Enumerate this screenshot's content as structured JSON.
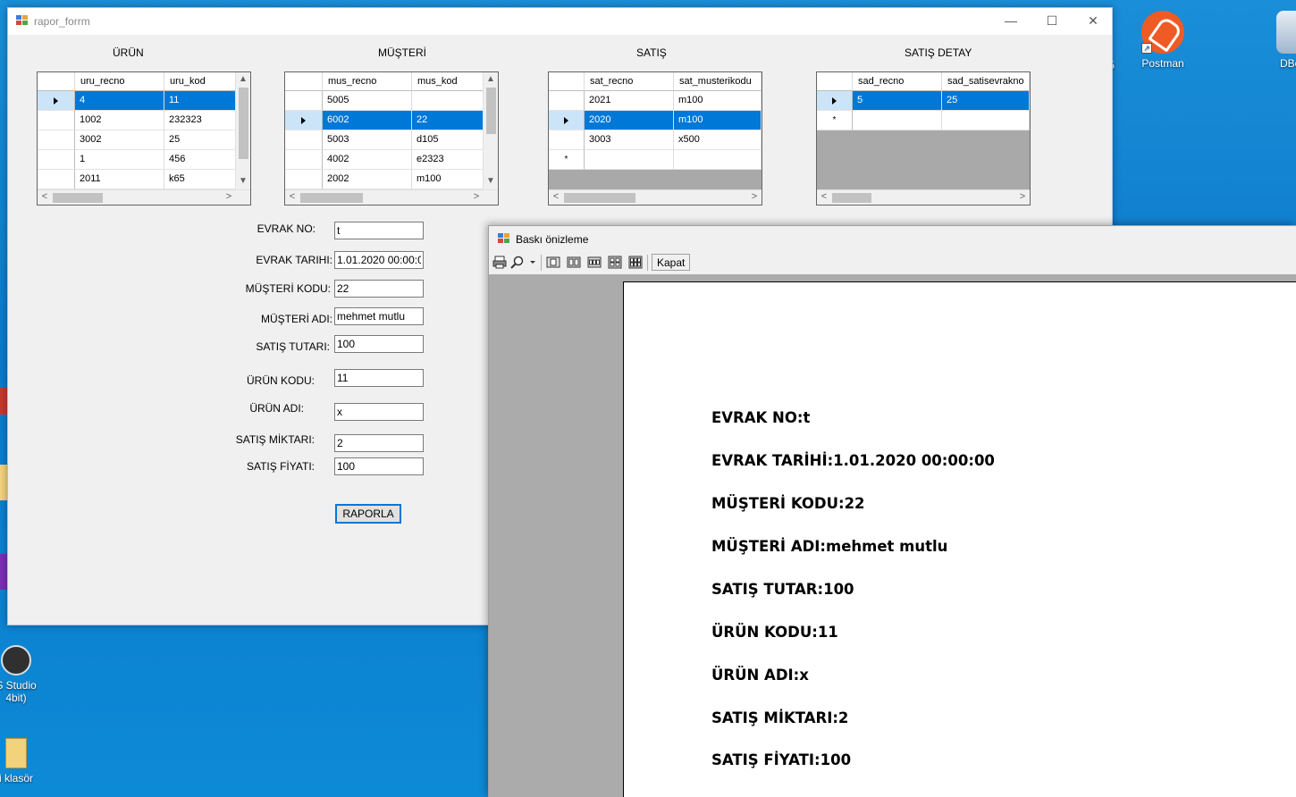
{
  "desktop": {
    "icons": [
      {
        "label": "Postman",
        "icon": "postman-icon"
      },
      {
        "label": "DBe",
        "icon": "dbeaver-icon"
      },
      {
        "label": ".5",
        "icon": "app-icon"
      },
      {
        "label": "S Studio",
        "label2": "4bit)",
        "icon": "obs-studio-icon"
      },
      {
        "label": "i klasör",
        "icon": "folder-icon"
      }
    ]
  },
  "main_window": {
    "title": "rapor_forrm",
    "groups": {
      "urun": {
        "label": "ÜRÜN",
        "columns": [
          "uru_recno",
          "uru_kod"
        ],
        "rows": [
          [
            "4",
            "11"
          ],
          [
            "1002",
            "232323"
          ],
          [
            "3002",
            "25"
          ],
          [
            "1",
            "456"
          ],
          [
            "2011",
            "k65"
          ]
        ]
      },
      "musteri": {
        "label": "MÜŞTERİ",
        "columns": [
          "mus_recno",
          "mus_kod"
        ],
        "rows": [
          [
            "5005",
            ""
          ],
          [
            "6002",
            "22"
          ],
          [
            "5003",
            "d105"
          ],
          [
            "4002",
            "e2323"
          ],
          [
            "2002",
            "m100"
          ]
        ]
      },
      "satis": {
        "label": "SATIŞ",
        "columns": [
          "sat_recno",
          "sat_musterikodu"
        ],
        "rows": [
          [
            "2021",
            "m100"
          ],
          [
            "2020",
            "m100"
          ],
          [
            "3003",
            "x500"
          ]
        ]
      },
      "satis_detay": {
        "label": "SATIŞ DETAY",
        "columns": [
          "sad_recno",
          "sad_satisevrakno"
        ],
        "rows": [
          [
            "5",
            "25"
          ]
        ]
      }
    },
    "form": {
      "evrak_no": {
        "label": "EVRAK NO:",
        "value": "t"
      },
      "evrak_tarihi": {
        "label": "EVRAK TARIHI:",
        "value": "1.01.2020 00:00:00"
      },
      "musteri_kodu": {
        "label": "MÜŞTERİ KODU:",
        "value": "22"
      },
      "musteri_adi": {
        "label": "MÜŞTERİ ADI:",
        "value": "mehmet mutlu"
      },
      "satis_tutari": {
        "label": "SATIŞ TUTARI:",
        "value": "100"
      },
      "urun_kodu": {
        "label": "ÜRÜN KODU:",
        "value": "11"
      },
      "urun_adi": {
        "label": "ÜRÜN ADI:",
        "value": "x"
      },
      "satis_miktari": {
        "label": "SATIŞ MİKTARI:",
        "value": "2"
      },
      "satis_fiyati": {
        "label": "SATIŞ FİYATI:",
        "value": "100"
      }
    },
    "raporla_label": "RAPORLA"
  },
  "preview_window": {
    "title": "Baskı önizleme",
    "kapat_label": "Kapat",
    "lines": [
      "EVRAK NO:t",
      "EVRAK TARİHİ:1.01.2020 00:00:00",
      "MÜŞTERİ KODU:22",
      "MÜŞTERİ ADI:mehmet mutlu",
      "SATIŞ TUTAR:100",
      "ÜRÜN KODU:11",
      "ÜRÜN ADI:x",
      "SATIŞ MİKTARI:2",
      "SATIŞ FİYATI:100"
    ]
  },
  "colors": {
    "selection": "#0078d7",
    "desktop": "#0b79c9",
    "preview_bg": "#ababab"
  }
}
